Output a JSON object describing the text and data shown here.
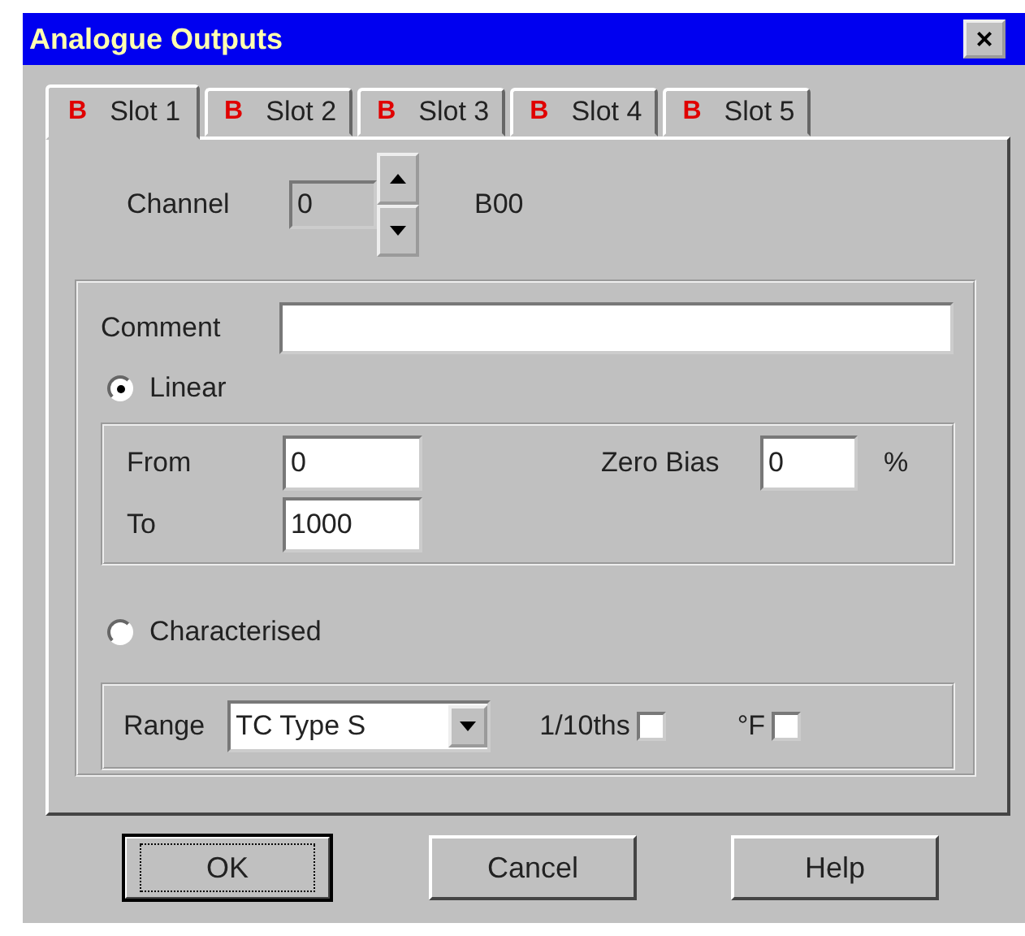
{
  "window": {
    "title": "Analogue Outputs",
    "close": "×"
  },
  "tabs": [
    {
      "icon": "B",
      "label": "Slot 1",
      "selected": true
    },
    {
      "icon": "B",
      "label": "Slot 2",
      "selected": false
    },
    {
      "icon": "B",
      "label": "Slot 3",
      "selected": false
    },
    {
      "icon": "B",
      "label": "Slot 4",
      "selected": false
    },
    {
      "icon": "B",
      "label": "Slot 5",
      "selected": false
    }
  ],
  "channel": {
    "label": "Channel",
    "value": "0",
    "address": "B00"
  },
  "comment": {
    "label": "Comment"
  },
  "modes": [
    {
      "label": "Linear",
      "selected": true
    },
    {
      "label": "Characterised",
      "selected": false
    }
  ],
  "linear": {
    "from_label": "From",
    "from": "0",
    "to_label": "To",
    "to": "1000",
    "zero_bias_label": "Zero Bias",
    "zero_bias": "0",
    "unit": "%"
  },
  "range": {
    "label": "Range",
    "value": "TC Type S",
    "checks": [
      {
        "label": "1/10ths",
        "checked": false
      },
      {
        "label": "°F",
        "checked": false
      }
    ]
  },
  "buttons": [
    {
      "label": "OK",
      "default": true
    },
    {
      "label": "Cancel",
      "default": false
    },
    {
      "label": "Help",
      "default": false
    }
  ]
}
